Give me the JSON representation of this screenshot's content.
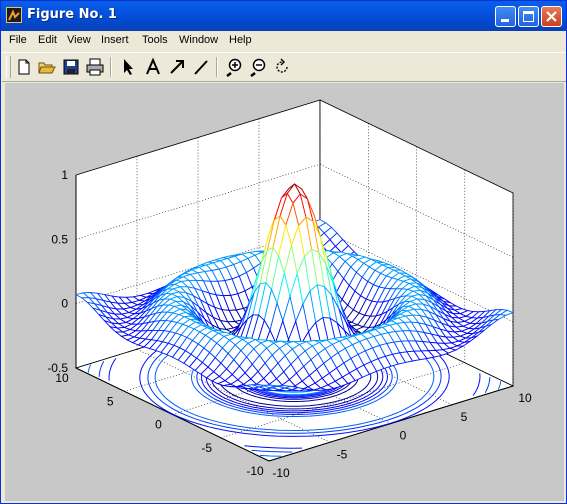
{
  "window": {
    "title": "Figure No. 1"
  },
  "menu": [
    "File",
    "Edit",
    "View",
    "Insert",
    "Tools",
    "Window",
    "Help"
  ],
  "toolbar": {
    "buttons": [
      "new-figure",
      "open-file",
      "save",
      "print",
      "select-arrow",
      "insert-text",
      "insert-arrow",
      "insert-line",
      "zoom-in",
      "zoom-out",
      "rotate-3d"
    ]
  },
  "plot": {
    "z_ticks": [
      "1",
      "0.5",
      "0",
      "-0.5"
    ],
    "y_ticks": [
      "10",
      "5",
      "0",
      "-5",
      "-10"
    ],
    "x_ticks": [
      "-10",
      "-5",
      "0",
      "5",
      "10"
    ]
  },
  "chart_data": {
    "type": "surface-mesh-with-contour",
    "function": "sin(r)/r",
    "x_range": [
      -10,
      10
    ],
    "y_range": [
      -10,
      10
    ],
    "z_range": [
      -0.5,
      1
    ],
    "z_ticks": [
      -0.5,
      0,
      0.5,
      1
    ],
    "x_ticks": [
      -10,
      -5,
      0,
      5,
      10
    ],
    "y_ticks": [
      -10,
      -5,
      0,
      5,
      10
    ],
    "grid": true,
    "colormap": "jet"
  }
}
